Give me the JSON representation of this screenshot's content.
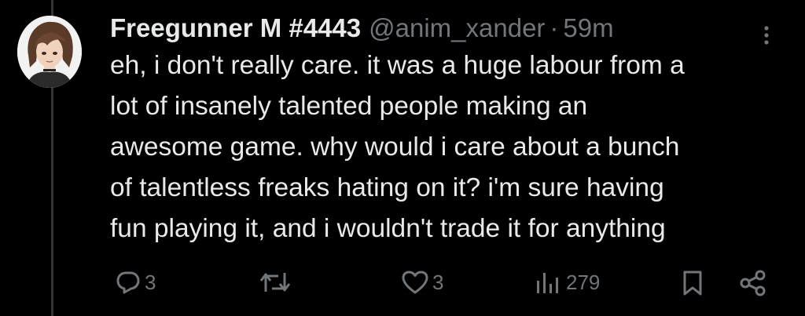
{
  "tweet": {
    "display_name": "Freegunner M #4443",
    "handle": "@anim_xander",
    "separator": "·",
    "time": "59m",
    "text_lines": [
      "eh, i don't really care. it was a huge labour from a",
      "lot of insanely talented people making an",
      "awesome game. why would i care about a bunch",
      "of talentless freaks hating on it? i'm sure having",
      "fun playing it, and i wouldn't trade it for anything"
    ]
  },
  "actions": {
    "replies": "3",
    "likes": "3",
    "views": "279"
  },
  "icons": {
    "reply": "reply-icon",
    "retweet": "retweet-icon",
    "like": "like-icon",
    "views": "views-icon",
    "bookmark": "bookmark-icon",
    "share": "share-icon",
    "more": "more-icon"
  },
  "colors": {
    "background": "#000000",
    "text": "#e7e9ea",
    "muted": "#71767b"
  }
}
